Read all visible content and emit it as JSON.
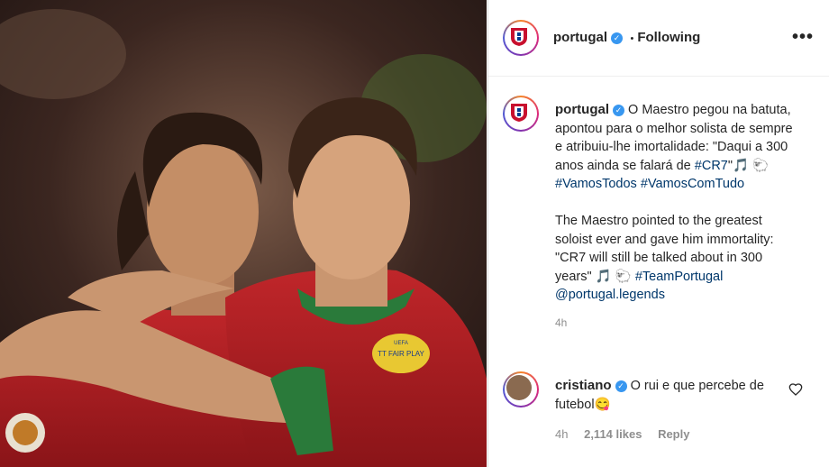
{
  "post": {
    "username": "portugal",
    "follow_dot": "•",
    "follow_status": "Following",
    "more_options": "•••"
  },
  "caption": {
    "username": "portugal",
    "pt_text": "O Maestro pegou na batuta, apontou para o melhor solista de sempre e atribuiu-lhe imortalidade: \"Daqui a 300 anos ainda se falará de ",
    "pt_tag_cr7": "#CR7",
    "pt_close": "\"🎵 🐑 ",
    "pt_tag1": "#VamosTodos",
    "pt_tag2": "#VamosComTudo",
    "en_text": "The Maestro pointed to the greatest soloist ever and gave him immortality: \"CR7 will still be talked about in 300 years\" 🎵 🐑 ",
    "en_tag": "#TeamPortugal",
    "en_mention": "@portugal.legends",
    "time": "4h"
  },
  "comment": {
    "username": "cristiano",
    "text": "O rui e que percebe de futebol😋",
    "time": "4h",
    "likes": "2,114 likes",
    "reply": "Reply"
  },
  "image": {
    "patch_text": "TT FAIR PLAY",
    "patch_top": "UEFA"
  }
}
